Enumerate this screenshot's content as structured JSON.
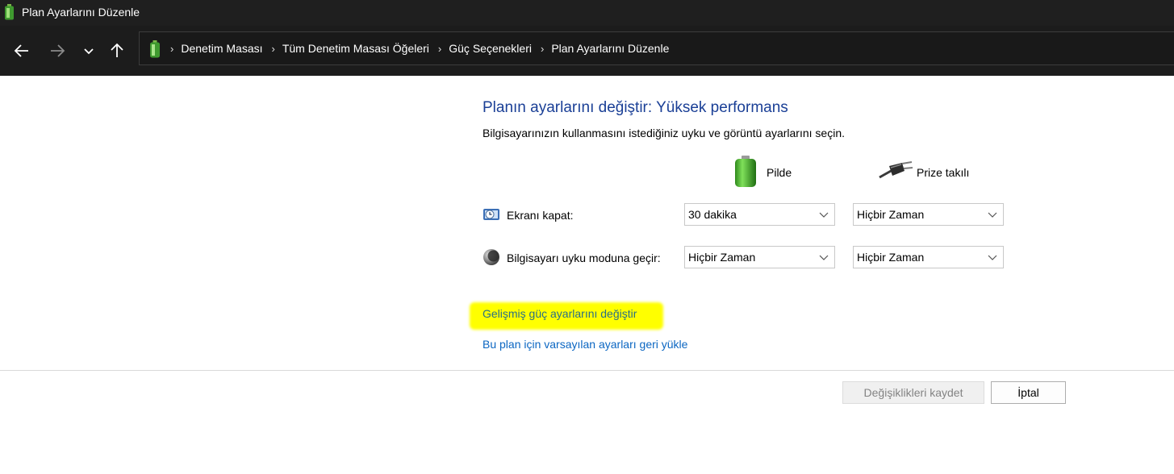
{
  "window": {
    "title": "Plan Ayarlarını Düzenle",
    "icon": "battery-icon"
  },
  "nav": {
    "back": "arrow-left-icon",
    "forward": "arrow-right-icon",
    "recent": "chevron-down-icon",
    "up": "arrow-up-icon",
    "breadcrumbs": [
      "Denetim Masası",
      "Tüm Denetim Masası Öğeleri",
      "Güç Seçenekleri",
      "Plan Ayarlarını Düzenle"
    ]
  },
  "main": {
    "heading": "Planın ayarlarını değiştir: Yüksek performans",
    "subtitle": "Bilgisayarınızın kullanmasını istediğiniz uyku ve görüntü ayarlarını seçin.",
    "columns": {
      "battery": "Pilde",
      "plugged": "Prize takılı"
    },
    "rows": [
      {
        "label": "Ekranı kapat:",
        "icon": "display-clock-icon",
        "battery_value": "30 dakika",
        "plugged_value": "Hiçbir Zaman"
      },
      {
        "label": "Bilgisayarı uyku moduna geçir:",
        "icon": "moon-sleep-icon",
        "battery_value": "Hiçbir Zaman",
        "plugged_value": "Hiçbir Zaman"
      }
    ],
    "links": {
      "advanced": "Gelişmiş güç ayarlarını değiştir",
      "restore": "Bu plan için varsayılan ayarları geri yükle"
    }
  },
  "footer": {
    "save": "Değişiklikleri kaydet",
    "cancel": "İptal"
  },
  "colors": {
    "titlebar": "#1f1f1f",
    "heading": "#1a3f96",
    "link": "#0b66c2",
    "highlight": "#ffff00"
  }
}
